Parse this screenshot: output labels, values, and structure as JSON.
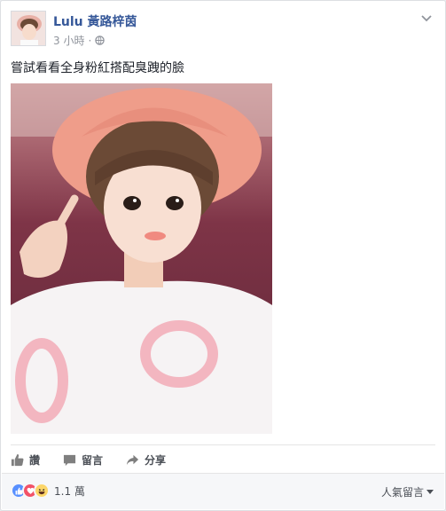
{
  "post": {
    "author": "Lulu 黃路梓茵",
    "time": "3 小時",
    "separator": "·",
    "privacy_icon": "globe-icon",
    "text": "嘗試看看全身粉紅搭配臭跩的臉"
  },
  "actions": {
    "like": "讚",
    "comment": "留言",
    "share": "分享"
  },
  "reactions": {
    "icons": [
      "like-icon",
      "love-icon",
      "haha-icon"
    ],
    "count": "1.1 萬",
    "sort_label": "人氣留言"
  },
  "colors": {
    "link": "#365899",
    "like_blue": "#5890ff",
    "love_red": "#f25268",
    "haha_yellow": "#fcd669"
  }
}
